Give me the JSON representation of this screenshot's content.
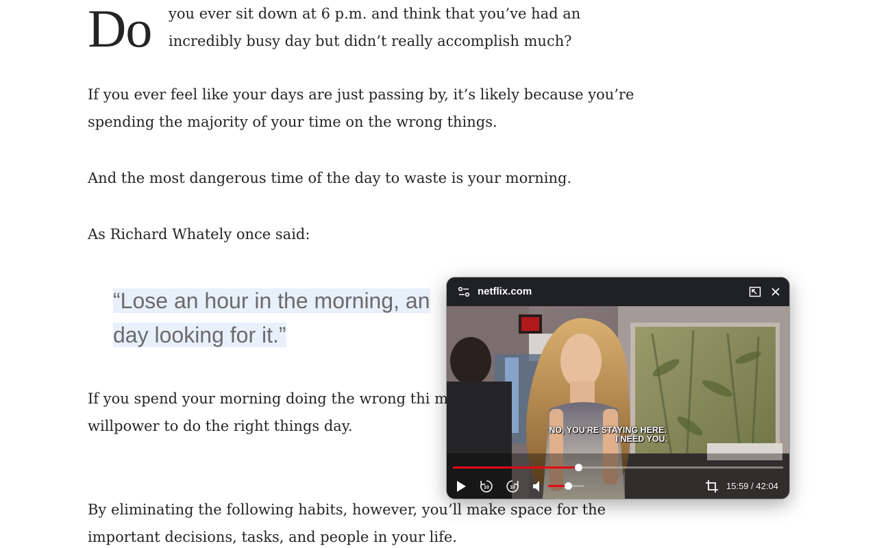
{
  "article": {
    "dropcap": "Do",
    "intro": "you ever sit down at 6 p.m. and think that you’ve had an incredibly busy day but didn’t really accomplish much?",
    "paragraphs": [
      "If you ever feel like your days are just passing by, it’s likely because you’re spending the majority of your time on the wrong things.",
      "And the most dangerous time of the day to waste is your morning.",
      "As Richard Whately once said:"
    ],
    "quote_line1": "“Lose an hour in the morning, an",
    "quote_line2": "day looking for it.”",
    "para_after_quote": "If you spend your morning doing the wrong thi motivation, and willpower to do the right things day.",
    "para_last": "By eliminating the following habits, however, you’ll make space for the important decisions, tasks, and people in your life."
  },
  "pip": {
    "site": "netflix.com",
    "subtitle_line1": "NO, YOU'RE STAYING HERE.",
    "subtitle_line2": "I NEED YOU.",
    "current_time": "15:59",
    "duration": "42:04",
    "time_display": "15:59 / 42:04",
    "progress_fraction": 0.38,
    "volume_fraction": 0.55,
    "icons": {
      "site": "tune-icon",
      "expand": "back-to-tab-icon",
      "close": "close-icon",
      "play": "play-icon",
      "back": "replay-10-icon",
      "forward": "forward-10-icon",
      "volume": "volume-icon",
      "crop": "crop-icon"
    },
    "colors": {
      "progress": "#e50914",
      "bar_bg": "#202124"
    }
  }
}
